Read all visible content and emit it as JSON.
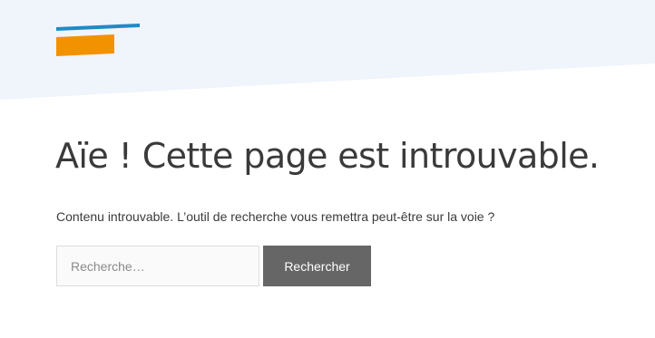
{
  "header": {
    "background_color": "#f0f4fb",
    "logo": {
      "icon": "logo-icon",
      "bar_color": "#1f8ac6",
      "block_color": "#f39200"
    }
  },
  "error": {
    "title": "Aïe ! Cette page est introuvable.",
    "message": "Contenu introuvable. L’outil de recherche vous remettra peut-être sur la voie ?"
  },
  "search": {
    "placeholder": "Recherche…",
    "value": "",
    "button_label": "Rechercher",
    "button_color": "#666666"
  }
}
